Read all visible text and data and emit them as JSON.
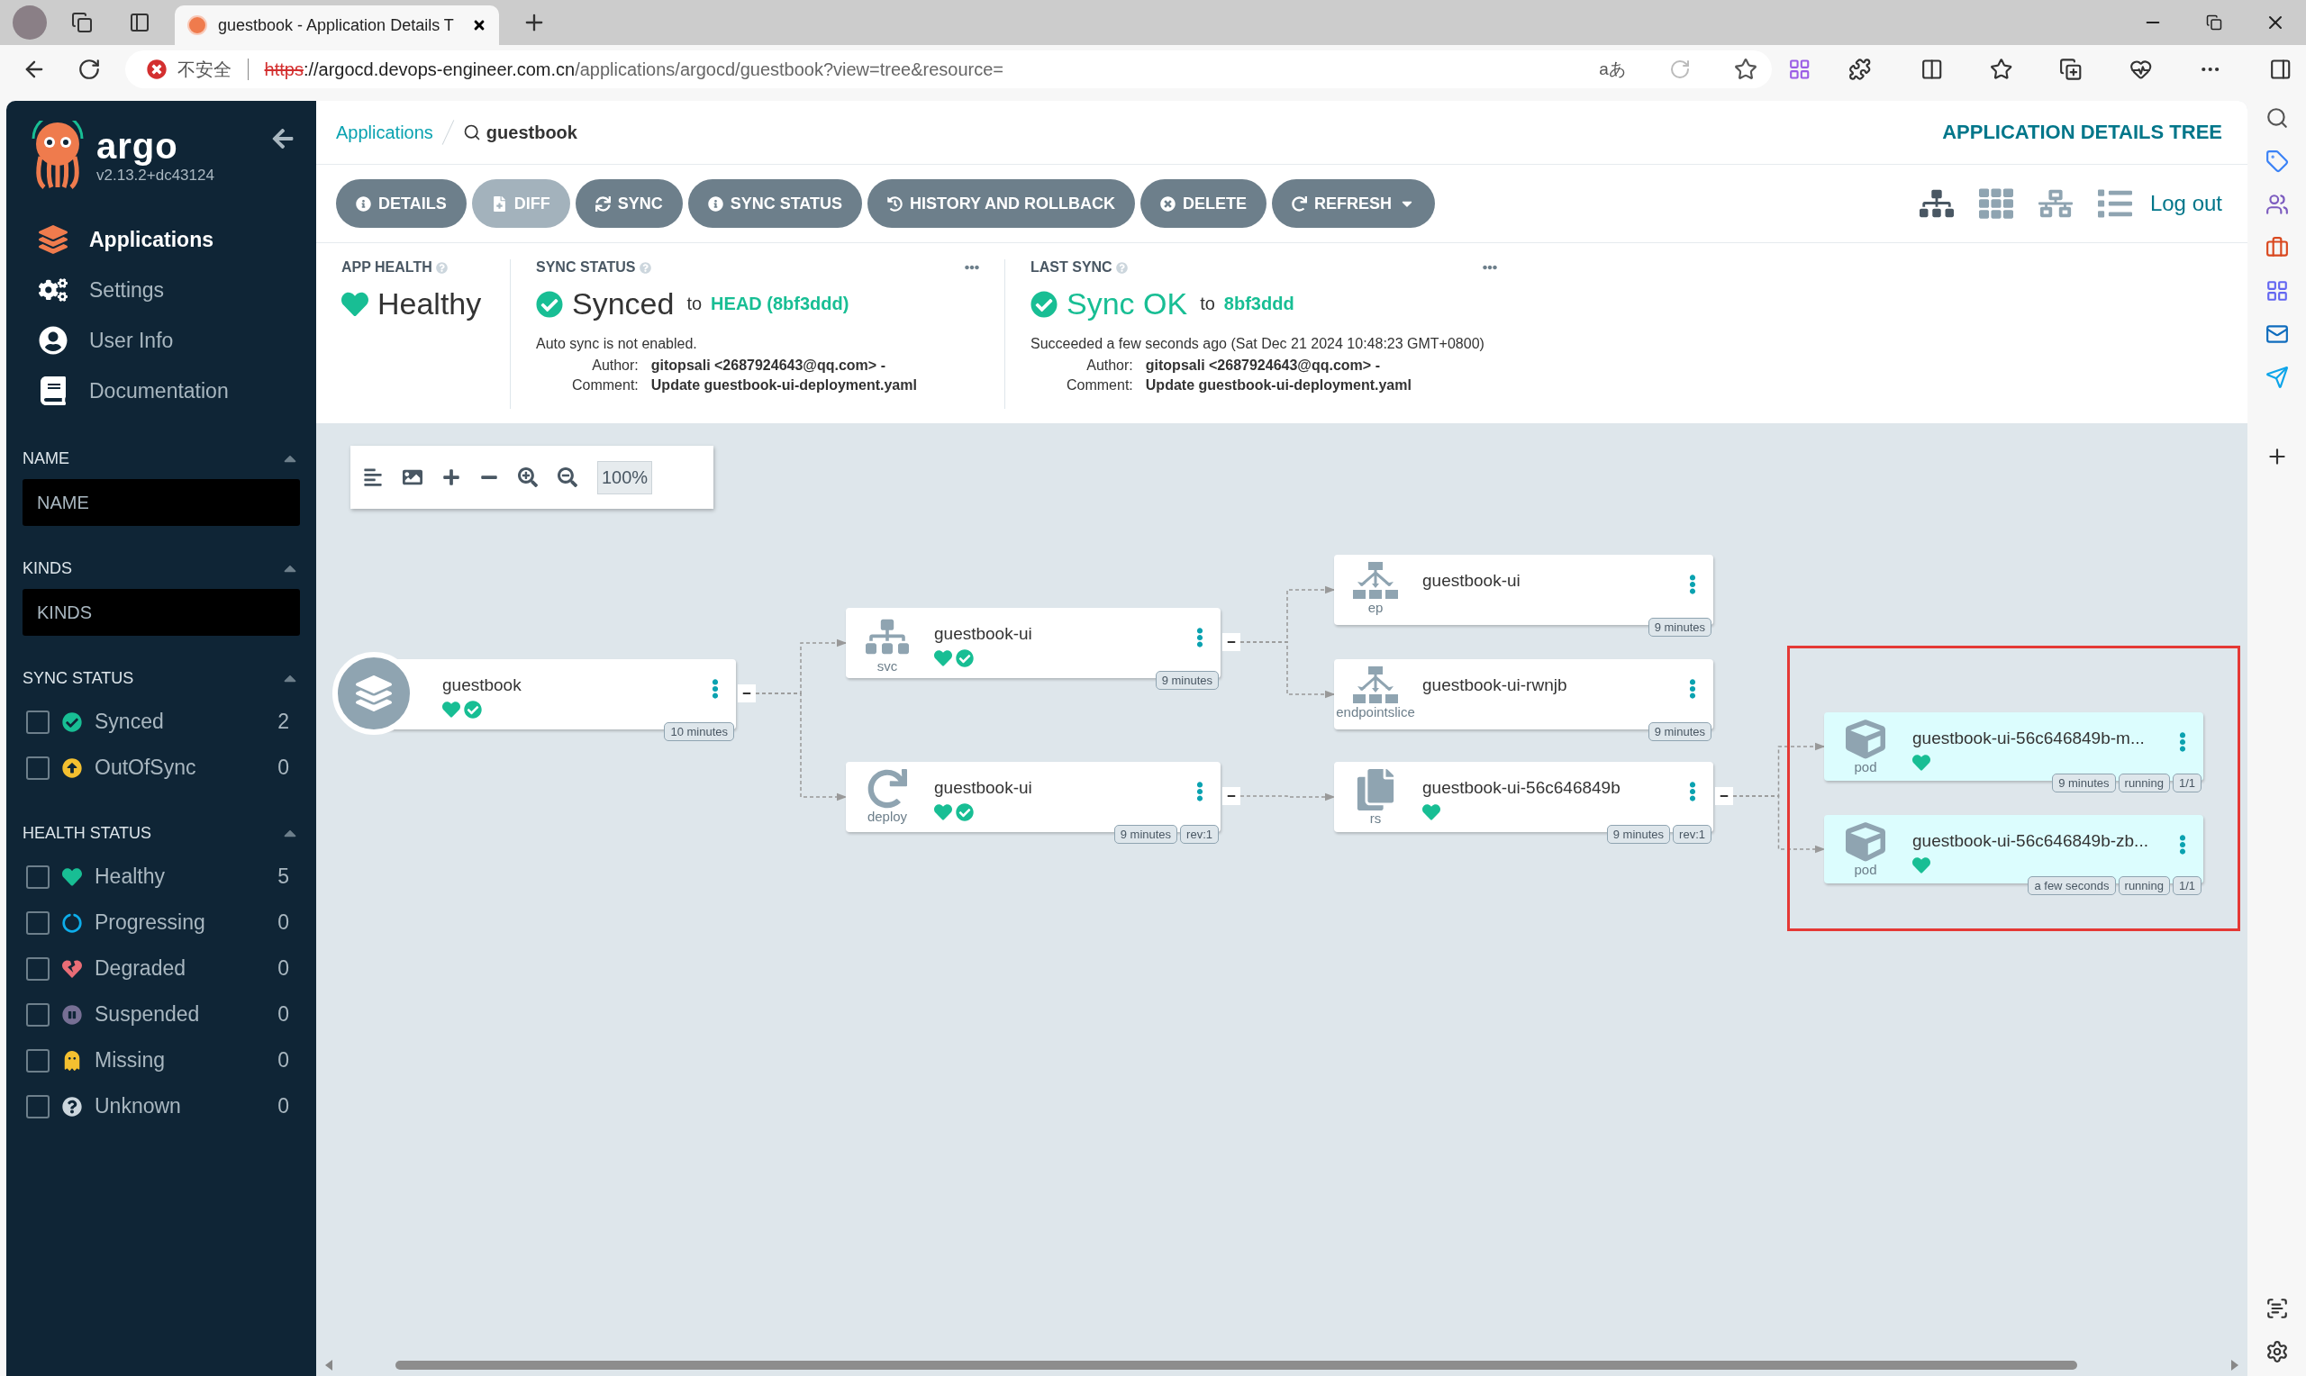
{
  "browser": {
    "tab_title": "guestbook - Application Details T",
    "security_label": "不安全",
    "url_scheme": "https",
    "url_host": "://argocd.devops-engineer.com.cn",
    "url_path": "/applications/argocd/guestbook?view=tree&resource=",
    "translate_label": "aあ"
  },
  "sidebar": {
    "brand": "argo",
    "version": "v2.13.2+dc43124",
    "nav": [
      {
        "label": "Applications",
        "selected": true
      },
      {
        "label": "Settings",
        "selected": false
      },
      {
        "label": "User Info",
        "selected": false
      },
      {
        "label": "Documentation",
        "selected": false
      }
    ],
    "filters": [
      {
        "kind": "input",
        "title": "NAME",
        "placeholder": "NAME"
      },
      {
        "kind": "input",
        "title": "KINDS",
        "placeholder": "KINDS"
      },
      {
        "kind": "checklist",
        "title": "SYNC STATUS",
        "items": [
          {
            "kind": "check",
            "label": "Synced",
            "count": "2",
            "checked": false,
            "color": "#18be94"
          },
          {
            "kind": "arrow",
            "label": "OutOfSync",
            "count": "0",
            "checked": false,
            "color": "#f4c030"
          }
        ]
      },
      {
        "kind": "checklist",
        "title": "HEALTH STATUS",
        "items": [
          {
            "kind": "heart",
            "label": "Healthy",
            "count": "5",
            "checked": false,
            "color": "#18be94"
          },
          {
            "kind": "spinner",
            "label": "Progressing",
            "count": "0",
            "checked": false,
            "color": "#0dadea"
          },
          {
            "kind": "broken-heart",
            "label": "Degraded",
            "count": "0",
            "checked": false,
            "color": "#e96d76"
          },
          {
            "kind": "pause",
            "label": "Suspended",
            "count": "0",
            "checked": false,
            "color": "#766f94"
          },
          {
            "kind": "ghost",
            "label": "Missing",
            "count": "0",
            "checked": false,
            "color": "#f4c030"
          },
          {
            "kind": "question",
            "label": "Unknown",
            "count": "0",
            "checked": false,
            "color": "#ccd6dd"
          }
        ]
      }
    ]
  },
  "header": {
    "breadcrumb": "Applications",
    "current": "guestbook",
    "title": "APPLICATION DETAILS TREE"
  },
  "toolbar": {
    "buttons": [
      {
        "label": "DETAILS",
        "disabled": false,
        "dropdown": false
      },
      {
        "label": "DIFF",
        "disabled": true,
        "dropdown": false
      },
      {
        "label": "SYNC",
        "disabled": false,
        "dropdown": false
      },
      {
        "label": "SYNC STATUS",
        "disabled": false,
        "dropdown": false
      },
      {
        "label": "HISTORY AND ROLLBACK",
        "disabled": false,
        "dropdown": false
      },
      {
        "label": "DELETE",
        "disabled": false,
        "dropdown": false
      },
      {
        "label": "REFRESH",
        "disabled": false,
        "dropdown": true
      }
    ],
    "view_modes": [
      {
        "selected": true
      },
      {
        "selected": false
      },
      {
        "selected": false
      },
      {
        "selected": false
      }
    ],
    "logout": "Log out"
  },
  "status": {
    "app_health": {
      "title": "APP HEALTH",
      "value": "Healthy"
    },
    "sync_status": {
      "title": "SYNC STATUS",
      "value": "Synced",
      "to": "to",
      "target": "HEAD (8bf3ddd)",
      "note": "Auto sync is not enabled.",
      "author_label": "Author:",
      "author": "gitopsali <2687924643@qq.com> -",
      "comment_label": "Comment:",
      "comment": "Update guestbook-ui-deployment.yaml"
    },
    "last_sync": {
      "title": "LAST SYNC",
      "value": "Sync OK",
      "to": "to",
      "target": "8bf3ddd",
      "note": "Succeeded a few seconds ago (Sat Dec 21 2024 10:48:23 GMT+0800)",
      "author_label": "Author:",
      "author": "gitopsali <2687924643@qq.com> -",
      "comment_label": "Comment:",
      "comment": "Update guestbook-ui-deployment.yaml"
    }
  },
  "graph": {
    "zoom": "100%",
    "highlight_frame": true,
    "root": {
      "kind": "app",
      "name": "guestbook",
      "healthy": true,
      "synced": true,
      "highlighted": false,
      "badges": [
        "10 minutes"
      ],
      "children": [
        {
          "kind": "svc",
          "type_label": "svc",
          "name": "guestbook-ui",
          "healthy": true,
          "synced": true,
          "highlighted": false,
          "badges": [
            "9 minutes"
          ],
          "children": [
            {
              "kind": "ep",
              "type_label": "ep",
              "name": "guestbook-ui",
              "healthy": false,
              "synced": false,
              "highlighted": false,
              "badges": [
                "9 minutes"
              ]
            },
            {
              "kind": "ep",
              "type_label": "endpointslice",
              "name": "guestbook-ui-rwnjb",
              "healthy": false,
              "synced": false,
              "highlighted": false,
              "badges": [
                "9 minutes"
              ]
            }
          ]
        },
        {
          "kind": "deploy",
          "type_label": "deploy",
          "name": "guestbook-ui",
          "healthy": true,
          "synced": true,
          "highlighted": false,
          "badges": [
            "9 minutes",
            "rev:1"
          ],
          "children": [
            {
              "kind": "rs",
              "type_label": "rs",
              "name": "guestbook-ui-56c646849b",
              "healthy": true,
              "synced": false,
              "highlighted": false,
              "badges": [
                "9 minutes",
                "rev:1"
              ],
              "children": [
                {
                  "kind": "pod",
                  "type_label": "pod",
                  "name": "guestbook-ui-56c646849b-m...",
                  "healthy": true,
                  "synced": false,
                  "highlighted": true,
                  "badges": [
                    "9 minutes",
                    "running",
                    "1/1"
                  ]
                },
                {
                  "kind": "pod",
                  "type_label": "pod",
                  "name": "guestbook-ui-56c646849b-zb...",
                  "healthy": true,
                  "synced": false,
                  "highlighted": true,
                  "badges": [
                    "a few seconds",
                    "running",
                    "1/1"
                  ]
                }
              ]
            }
          ]
        }
      ]
    }
  }
}
